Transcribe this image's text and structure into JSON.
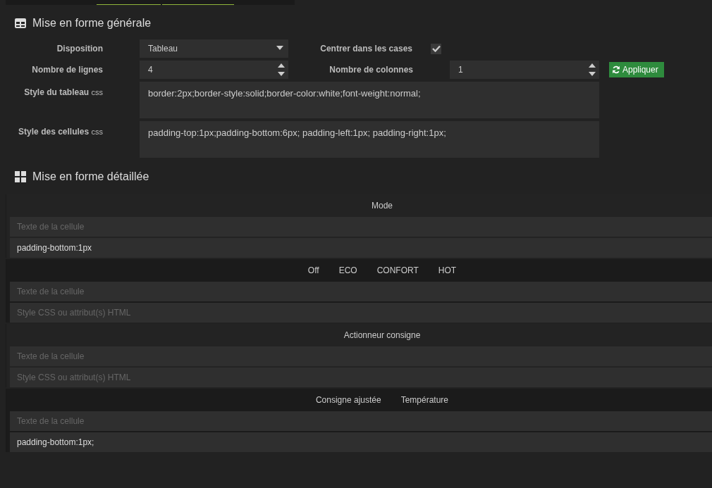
{
  "general": {
    "title": "Mise en forme générale",
    "disposition": {
      "label": "Disposition",
      "value": "Tableau"
    },
    "center": {
      "label": "Centrer dans les cases",
      "checked": true
    },
    "rows": {
      "label": "Nombre de lignes",
      "value": "4"
    },
    "columns": {
      "label": "Nombre de colonnes",
      "value": "1"
    },
    "apply_button": "Appliquer",
    "table_style": {
      "label": "Style du tableau",
      "suffix": "css",
      "value": "border:2px;border-style:solid;border-color:white;font-weight:normal;"
    },
    "cell_style": {
      "label": "Style des cellules",
      "suffix": "css",
      "value": "padding-top:1px;padding-bottom:6px; padding-left:1px; padding-right:1px;"
    }
  },
  "detailed": {
    "title": "Mise en forme détaillée",
    "blocks": [
      {
        "items": [
          "Mode"
        ],
        "text_field": {
          "placeholder": "Texte de la cellule"
        },
        "style_field": {
          "value": "padding-bottom:1px"
        }
      },
      {
        "items": [
          "Off",
          "ECO",
          "CONFORT",
          "HOT"
        ],
        "text_field": {
          "placeholder": "Texte de la cellule"
        },
        "style_field": {
          "placeholder": "Style CSS ou attribut(s) HTML"
        }
      },
      {
        "items": [
          "Actionneur consigne"
        ],
        "text_field": {
          "placeholder": "Texte de la cellule"
        },
        "style_field": {
          "placeholder": "Style CSS ou attribut(s) HTML"
        }
      },
      {
        "items": [
          "Consigne ajustée",
          "Température"
        ],
        "text_field": {
          "placeholder": "Texte de la cellule"
        },
        "style_field": {
          "value": "padding-bottom:1px;"
        }
      }
    ]
  }
}
